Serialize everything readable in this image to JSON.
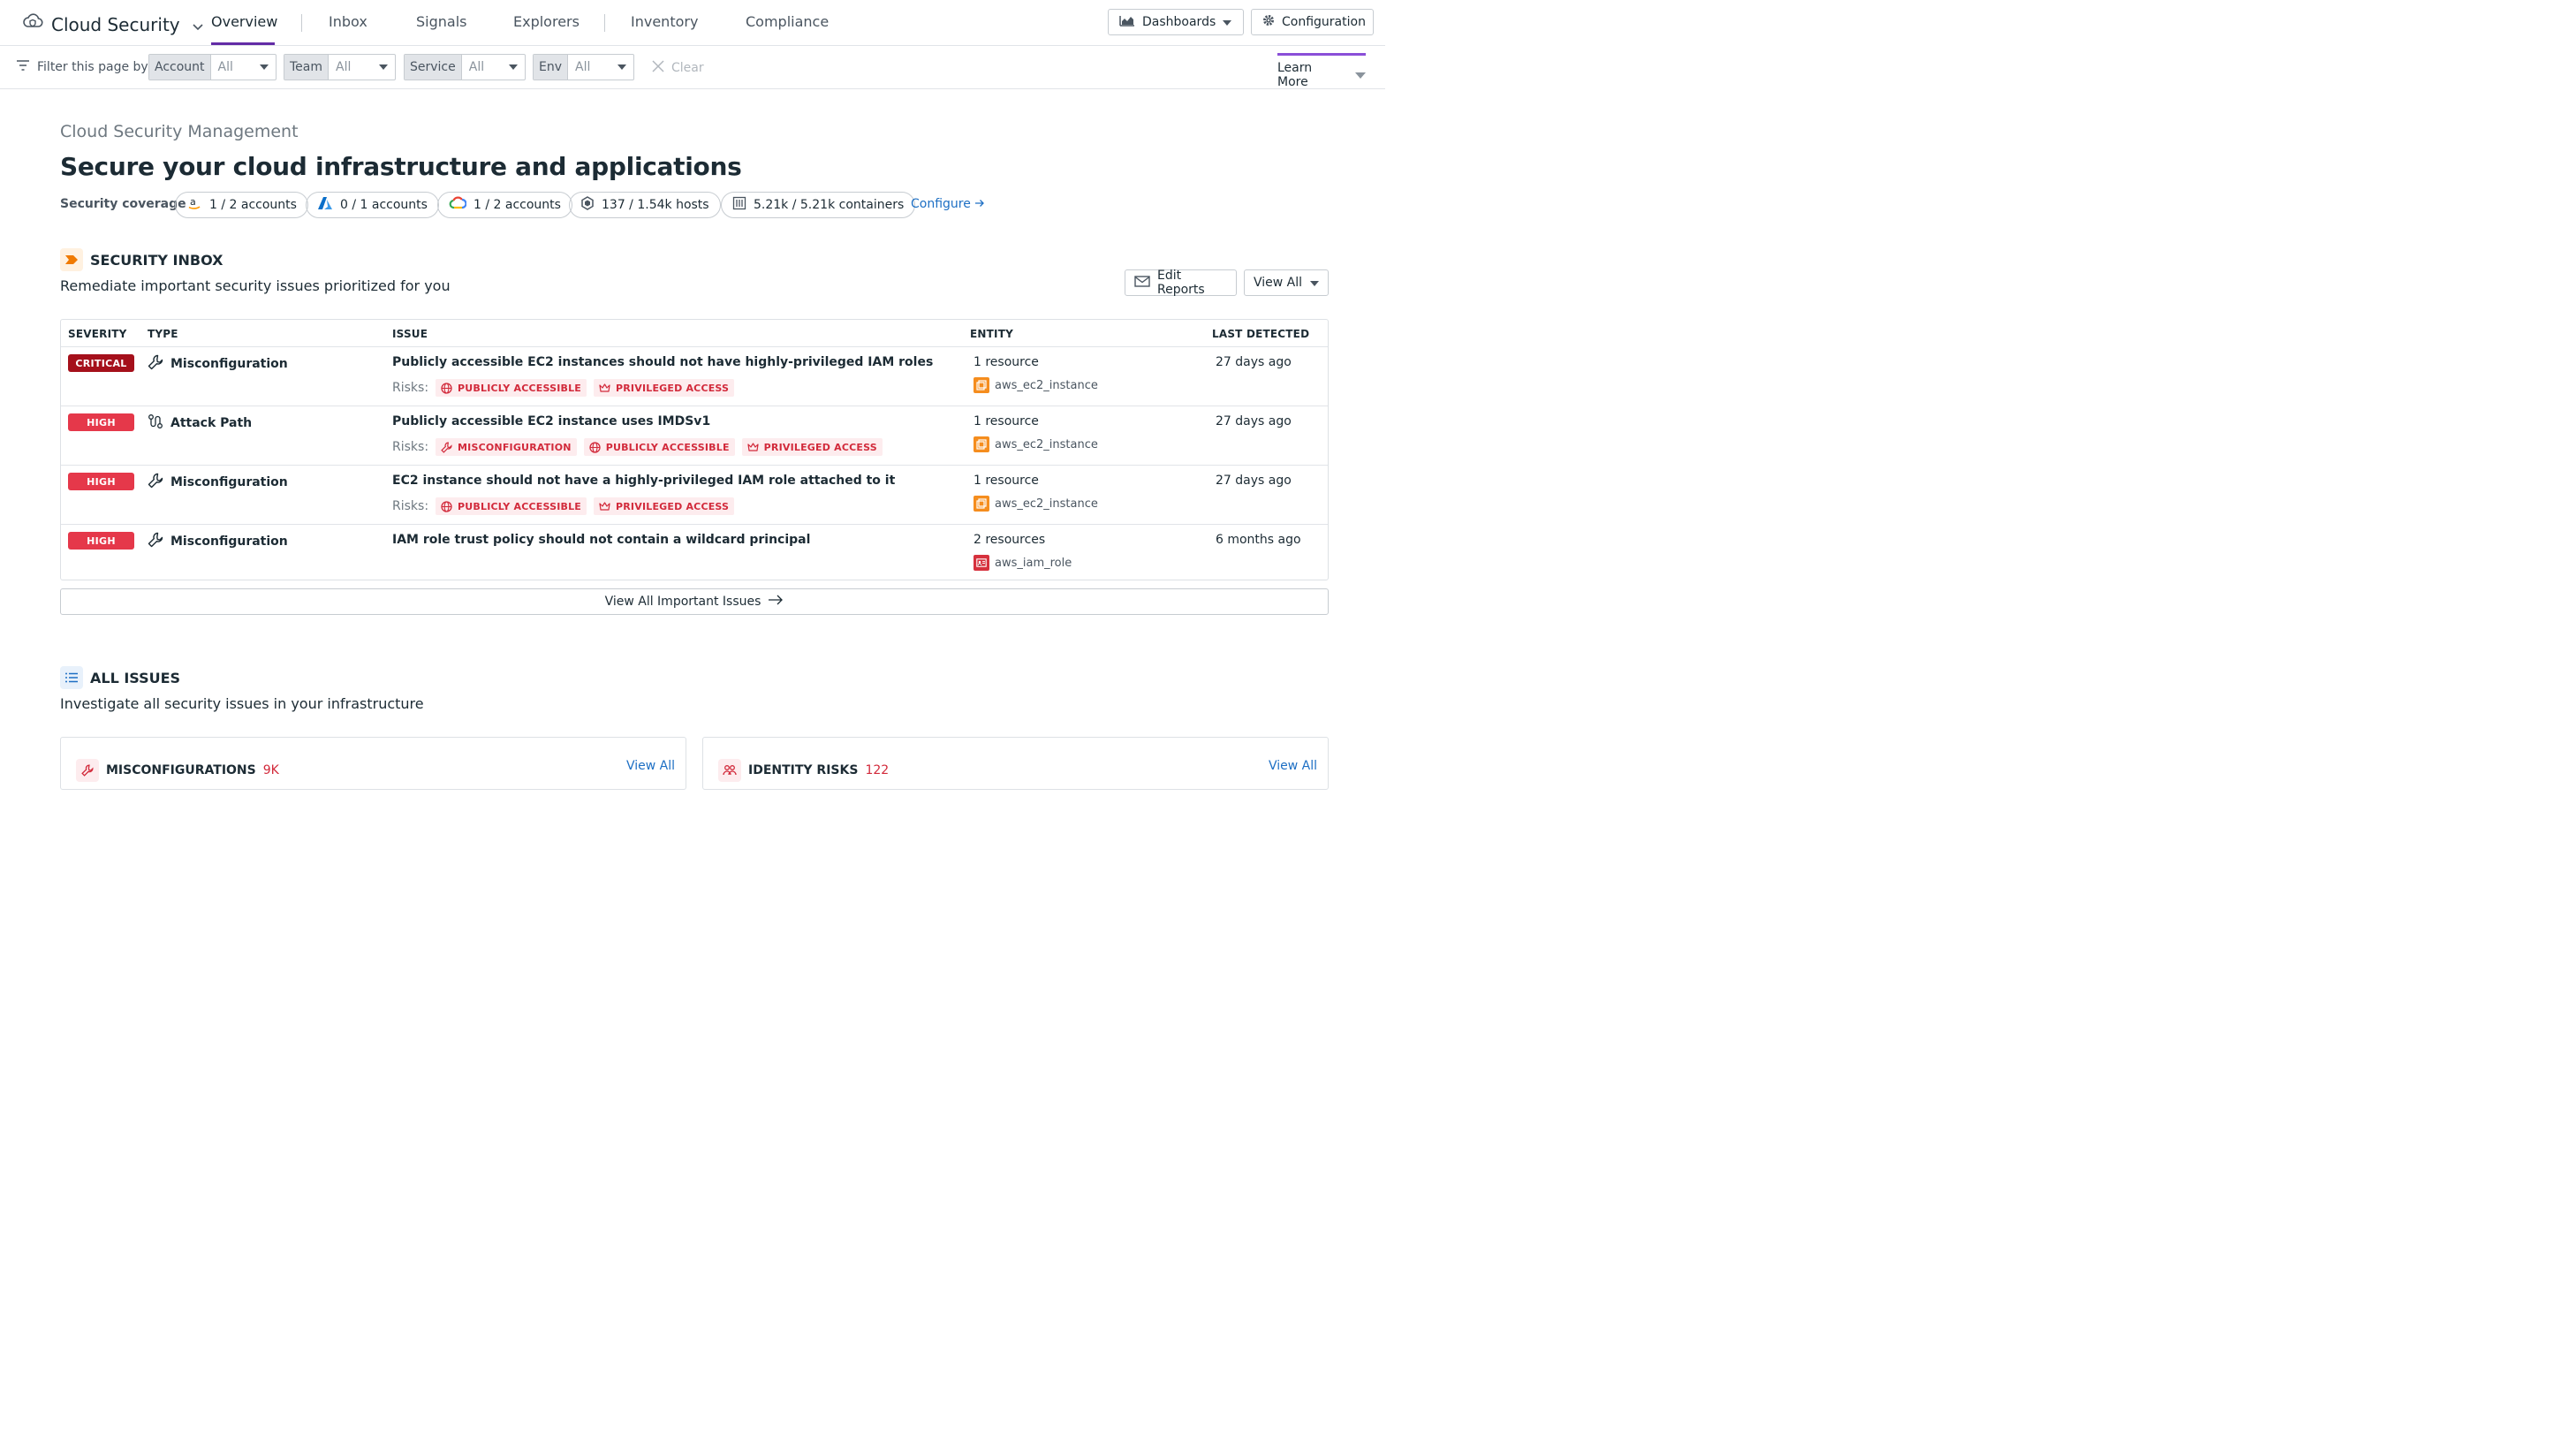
{
  "nav": {
    "product": "Cloud Security",
    "tabs": [
      "Overview",
      "Inbox",
      "Signals",
      "Explorers",
      "Inventory",
      "Compliance"
    ],
    "active_tab": "Overview",
    "dashboards_label": "Dashboards",
    "configuration_label": "Configuration"
  },
  "filters": {
    "label": "Filter this page by",
    "items": [
      {
        "name": "Account",
        "value": "All"
      },
      {
        "name": "Team",
        "value": "All"
      },
      {
        "name": "Service",
        "value": "All"
      },
      {
        "name": "Env",
        "value": "All"
      }
    ],
    "clear_label": "Clear",
    "learn_more_label": "Learn More"
  },
  "hero": {
    "eyebrow": "Cloud Security Management",
    "title": "Secure your cloud infrastructure and applications",
    "coverage_label": "Security coverage",
    "chips": [
      {
        "icon": "aws-icon",
        "text": "1 / 2 accounts"
      },
      {
        "icon": "azure-icon",
        "text": "0 / 1 accounts"
      },
      {
        "icon": "gcp-icon",
        "text": "1 / 2 accounts"
      },
      {
        "icon": "host-icon",
        "text": "137 / 1.54k hosts"
      },
      {
        "icon": "container-icon",
        "text": "5.21k / 5.21k containers"
      }
    ],
    "configure_label": "Configure"
  },
  "inbox": {
    "title": "SECURITY INBOX",
    "description": "Remediate important security issues prioritized for you",
    "edit_reports_label": "Edit Reports",
    "view_all_label": "View All",
    "columns": [
      "SEVERITY",
      "TYPE",
      "ISSUE",
      "ENTITY",
      "LAST DETECTED"
    ],
    "risks_label": "Risks:",
    "rows": [
      {
        "severity": "CRITICAL",
        "type": "Misconfiguration",
        "issue": "Publicly accessible EC2 instances should not have highly-privileged IAM roles",
        "risks": [
          "PUBLICLY ACCESSIBLE",
          "PRIVILEGED ACCESS"
        ],
        "entity_count": "1 resource",
        "entity_type": "aws_ec2_instance",
        "last_detected": "27 days ago"
      },
      {
        "severity": "HIGH",
        "type": "Attack Path",
        "issue": "Publicly accessible EC2 instance uses IMDSv1",
        "risks": [
          "MISCONFIGURATION",
          "PUBLICLY ACCESSIBLE",
          "PRIVILEGED ACCESS"
        ],
        "entity_count": "1 resource",
        "entity_type": "aws_ec2_instance",
        "last_detected": "27 days ago"
      },
      {
        "severity": "HIGH",
        "type": "Misconfiguration",
        "issue": "EC2 instance should not have a highly-privileged IAM role attached to it",
        "risks": [
          "PUBLICLY ACCESSIBLE",
          "PRIVILEGED ACCESS"
        ],
        "entity_count": "1 resource",
        "entity_type": "aws_ec2_instance",
        "last_detected": "27 days ago"
      },
      {
        "severity": "HIGH",
        "type": "Misconfiguration",
        "issue": "IAM role trust policy should not contain a wildcard principal",
        "risks": [],
        "entity_count": "2 resources",
        "entity_type": "aws_iam_role",
        "last_detected": "6 months ago"
      }
    ],
    "view_all_issues_label": "View All Important Issues"
  },
  "all_issues": {
    "title": "ALL ISSUES",
    "description": "Investigate all security issues in your infrastructure",
    "cards": [
      {
        "title": "MISCONFIGURATIONS",
        "count": "9K",
        "link": "View All"
      },
      {
        "title": "IDENTITY RISKS",
        "count": "122",
        "link": "View All"
      }
    ]
  },
  "colors": {
    "accent": "#632ca6",
    "critical": "#a5101b",
    "high": "#e5384a",
    "link": "#1d6fc4"
  }
}
